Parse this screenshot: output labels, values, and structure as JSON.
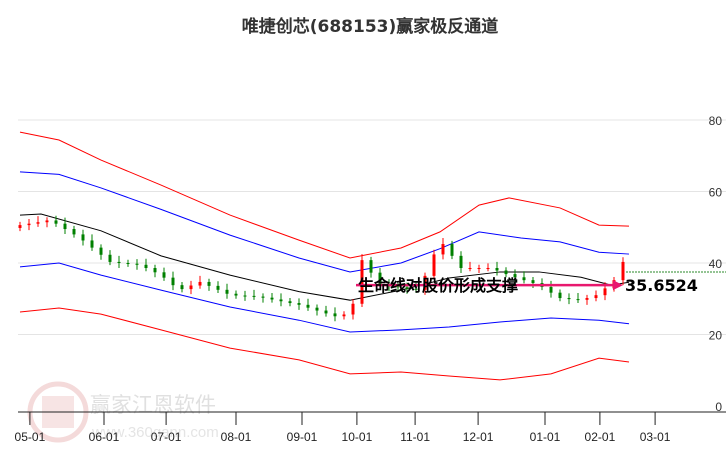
{
  "chart_data": {
    "type": "candlestick-with-bands",
    "title": "唯捷创芯(688153)赢家极反通道",
    "ylim": [
      0,
      80
    ],
    "yticks": [
      0,
      20,
      40,
      60,
      80
    ],
    "x_unit": "trading-day index",
    "xlim": [
      0,
      237
    ],
    "xticks": [
      {
        "label": "05-01",
        "x": 3.3
      },
      {
        "label": "06-01",
        "x": 28
      },
      {
        "label": "07-01",
        "x": 48.7
      },
      {
        "label": "08-01",
        "x": 72
      },
      {
        "label": "09-01",
        "x": 94
      },
      {
        "label": "10-01",
        "x": 112.3
      },
      {
        "label": "11-01",
        "x": 131.7
      },
      {
        "label": "12-01",
        "x": 152.7
      },
      {
        "label": "01-01",
        "x": 175
      },
      {
        "label": "02-01",
        "x": 193.3
      },
      {
        "label": "03-01",
        "x": 211.7
      }
    ],
    "closes_step": 3,
    "closes": [
      50.6,
      51.0,
      51.4,
      51.9,
      51.0,
      49.5,
      48.0,
      46.3,
      44.3,
      42.3,
      40.3,
      40.0,
      39.8,
      39.5,
      38.6,
      37.4,
      35.9,
      33.8,
      32.7,
      33.7,
      34.7,
      33.6,
      32.5,
      31.4,
      30.9,
      30.8,
      30.6,
      30.3,
      29.8,
      29.3,
      28.8,
      28.3,
      27.5,
      26.7,
      25.9,
      25.1,
      25.6,
      28.6,
      40.8,
      37.3,
      33.8,
      33.5,
      33.2,
      32.8,
      32.5,
      36.4,
      42.4,
      45.3,
      42.0,
      38.6,
      38.6,
      38.6,
      38.6,
      37.9,
      36.9,
      36.0,
      35.2,
      34.4,
      33.3,
      31.7,
      30.2,
      29.9,
      29.7,
      30.2,
      31.0,
      32.9,
      35.2,
      40.3
    ],
    "series": [
      {
        "name": "red-upper",
        "color": "#ff0000",
        "x": [
          0,
          13,
          27,
          47,
          70,
          93,
          110,
          127,
          140,
          153,
          163,
          180,
          193,
          203
        ],
        "values": [
          76.6,
          74.4,
          68.8,
          61.8,
          53.4,
          46.4,
          41.4,
          44.2,
          48.7,
          56.2,
          58.2,
          55.4,
          50.6,
          50.3
        ]
      },
      {
        "name": "blue-upper",
        "color": "#0000ff",
        "x": [
          0,
          13,
          27,
          47,
          70,
          93,
          110,
          127,
          140,
          153,
          167,
          180,
          193,
          203
        ],
        "values": [
          65.5,
          64.8,
          61,
          55,
          47.8,
          41.4,
          37.5,
          40,
          44,
          48.7,
          47,
          45.9,
          43,
          42.5
        ]
      },
      {
        "name": "lifeline",
        "color": "#000000",
        "x": [
          0,
          7,
          27,
          47,
          70,
          93,
          110,
          127,
          143,
          160,
          173,
          187,
          197,
          203
        ],
        "values": [
          53.4,
          53.7,
          49,
          42,
          36.6,
          32,
          29.6,
          32.4,
          35.8,
          37.5,
          37.5,
          36,
          33.8,
          34.6
        ]
      },
      {
        "name": "blue-lower",
        "color": "#0000ff",
        "x": [
          0,
          13,
          27,
          47,
          70,
          93,
          110,
          127,
          143,
          160,
          177,
          193,
          203
        ],
        "values": [
          38.9,
          40,
          36.6,
          32.4,
          27.7,
          24,
          20.7,
          21.3,
          22.1,
          23.5,
          24.6,
          24,
          23
        ]
      },
      {
        "name": "red-lower",
        "color": "#ff0000",
        "x": [
          0,
          13,
          27,
          47,
          70,
          93,
          110,
          127,
          143,
          160,
          177,
          193,
          203
        ],
        "values": [
          26.3,
          27.4,
          25.7,
          21.3,
          16.2,
          12.9,
          9,
          9.5,
          8.4,
          7.3,
          9,
          13.4,
          12.3
        ]
      }
    ],
    "last_price_line": 37.5,
    "annotation": {
      "text": "生命线对股价形成支撑",
      "value_label": "35.6524",
      "value": 33.8,
      "x_from": 112,
      "x_to": 201,
      "color": "#e8186e"
    }
  },
  "watermark": {
    "logo_chars": "江赢恩家",
    "name": "赢家江恩软件",
    "url": "www.360gann.com"
  }
}
